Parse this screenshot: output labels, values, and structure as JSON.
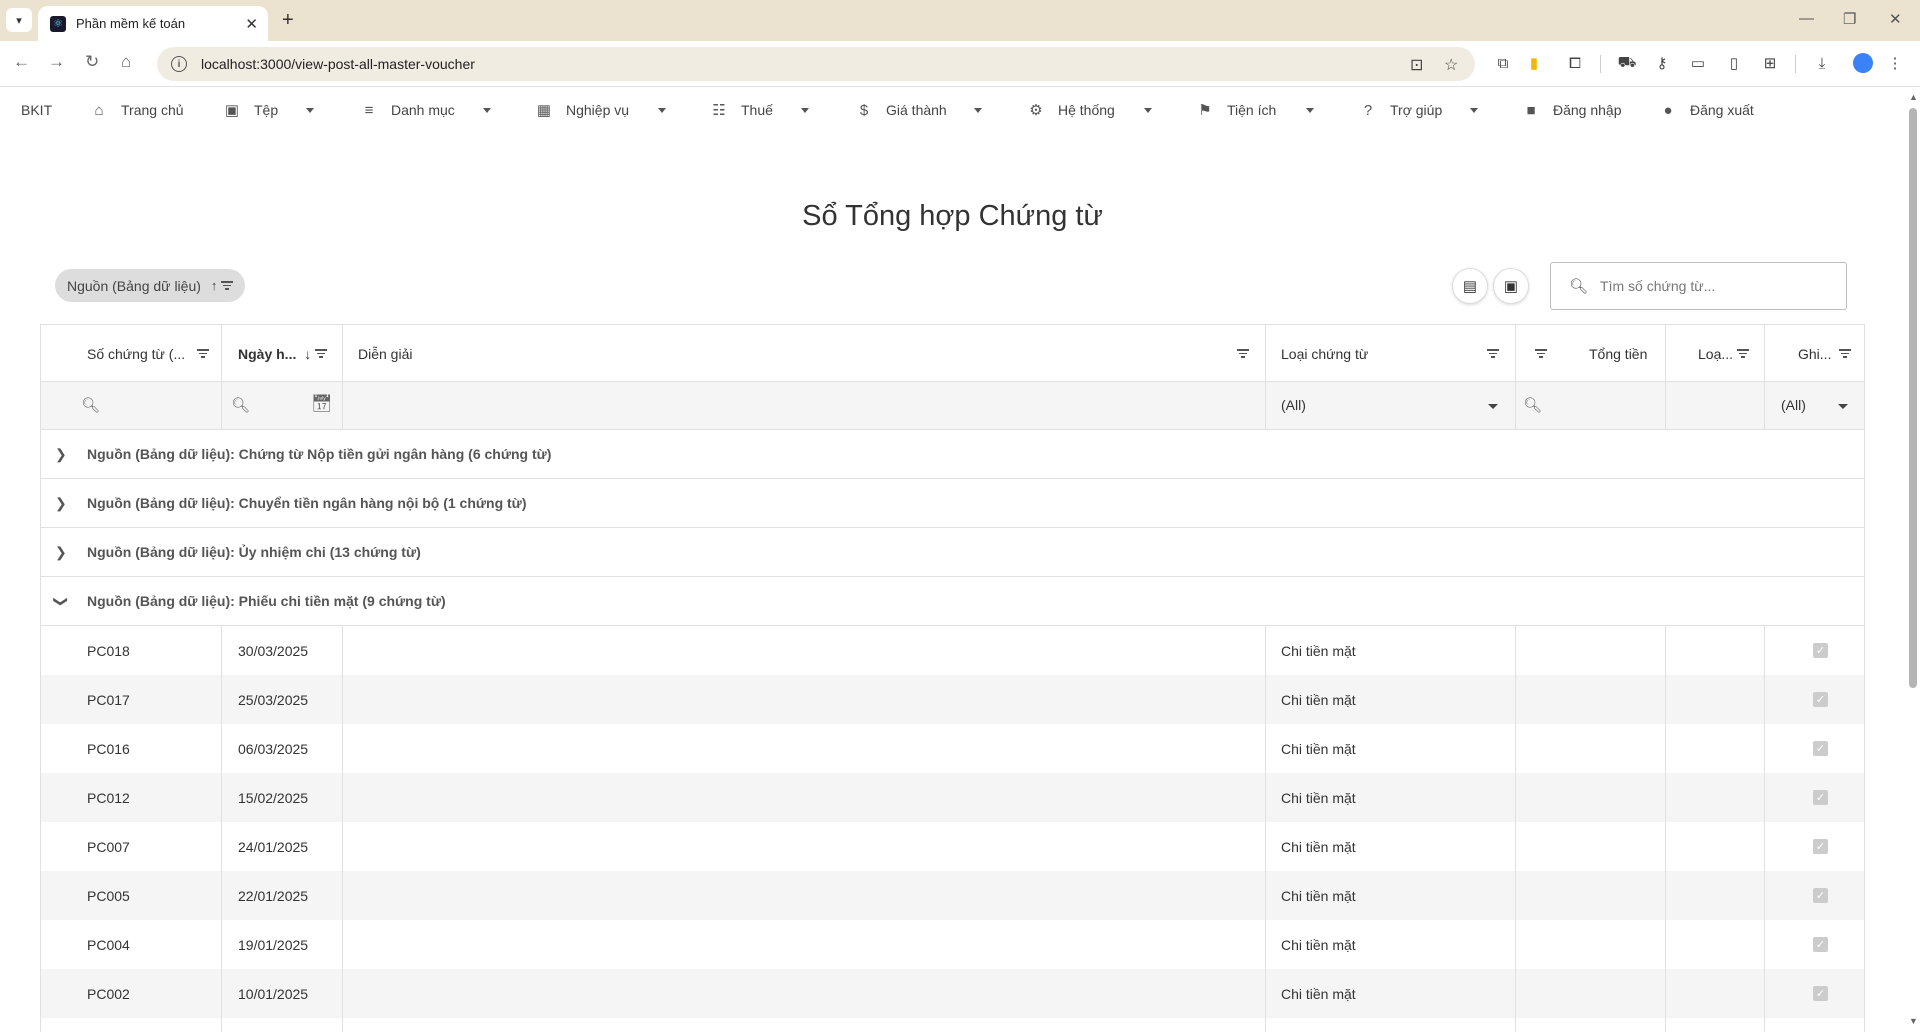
{
  "browser": {
    "tab_title": "Phần mềm kế toán",
    "url": "localhost:3000/view-post-all-master-voucher"
  },
  "menu": {
    "brand": "BKIT",
    "items": [
      {
        "label": "Trang chủ",
        "icon": "home-icon",
        "has_caret": false
      },
      {
        "label": "Tệp",
        "icon": "save-icon",
        "has_caret": true
      },
      {
        "label": "Danh mục",
        "icon": "list-icon",
        "has_caret": true
      },
      {
        "label": "Nghiệp vụ",
        "icon": "grid-icon",
        "has_caret": true
      },
      {
        "label": "Thuế",
        "icon": "checklist-icon",
        "has_caret": true
      },
      {
        "label": "Giá thành",
        "icon": "dollar-icon",
        "has_caret": true
      },
      {
        "label": "Hệ thống",
        "icon": "gear-icon",
        "has_caret": true
      },
      {
        "label": "Tiện ích",
        "icon": "run-icon",
        "has_caret": true
      },
      {
        "label": "Trợ giúp",
        "icon": "help-icon",
        "has_caret": true
      },
      {
        "label": "Đăng nhập",
        "icon": "login-icon",
        "has_caret": false
      },
      {
        "label": "Đăng xuất",
        "icon": "logout-icon",
        "has_caret": false
      }
    ]
  },
  "page": {
    "title": "Sổ Tổng hợp Chứng từ",
    "group_chip": "Nguồn (Bảng dữ liệu)",
    "search_placeholder": "Tìm số chứng từ..."
  },
  "grid": {
    "columns": [
      "Số chứng từ (...",
      "Ngày h...",
      "Diễn giải",
      "Loại chứng từ",
      "Tổng tiền",
      "Loạ...",
      "Ghi..."
    ],
    "filter_all_label": "(All)",
    "groups": [
      {
        "label": "Nguồn (Bảng dữ liệu): Chứng từ Nộp tiền gửi ngân hàng (6 chứng từ)",
        "expanded": false
      },
      {
        "label": "Nguồn (Bảng dữ liệu): Chuyển tiền ngân hàng nội bộ (1 chứng từ)",
        "expanded": false
      },
      {
        "label": "Nguồn (Bảng dữ liệu): Ủy nhiệm chi (13 chứng từ)",
        "expanded": false
      },
      {
        "label": "Nguồn (Bảng dữ liệu): Phiếu chi tiền mặt (9 chứng từ)",
        "expanded": true
      }
    ],
    "rows": [
      {
        "so": "PC018",
        "ngay": "30/03/2025",
        "dien_giai": "",
        "loai": "Chi tiền mặt",
        "tong_tien": "",
        "loa": "",
        "ghi": true
      },
      {
        "so": "PC017",
        "ngay": "25/03/2025",
        "dien_giai": "",
        "loai": "Chi tiền mặt",
        "tong_tien": "",
        "loa": "",
        "ghi": true
      },
      {
        "so": "PC016",
        "ngay": "06/03/2025",
        "dien_giai": "",
        "loai": "Chi tiền mặt",
        "tong_tien": "",
        "loa": "",
        "ghi": true
      },
      {
        "so": "PC012",
        "ngay": "15/02/2025",
        "dien_giai": "",
        "loai": "Chi tiền mặt",
        "tong_tien": "",
        "loa": "",
        "ghi": true
      },
      {
        "so": "PC007",
        "ngay": "24/01/2025",
        "dien_giai": "",
        "loai": "Chi tiền mặt",
        "tong_tien": "",
        "loa": "",
        "ghi": true
      },
      {
        "so": "PC005",
        "ngay": "22/01/2025",
        "dien_giai": "",
        "loai": "Chi tiền mặt",
        "tong_tien": "",
        "loa": "",
        "ghi": true
      },
      {
        "so": "PC004",
        "ngay": "19/01/2025",
        "dien_giai": "",
        "loai": "Chi tiền mặt",
        "tong_tien": "",
        "loa": "",
        "ghi": true
      },
      {
        "so": "PC002",
        "ngay": "10/01/2025",
        "dien_giai": "",
        "loai": "Chi tiền mặt",
        "tong_tien": "",
        "loa": "",
        "ghi": true
      }
    ]
  }
}
